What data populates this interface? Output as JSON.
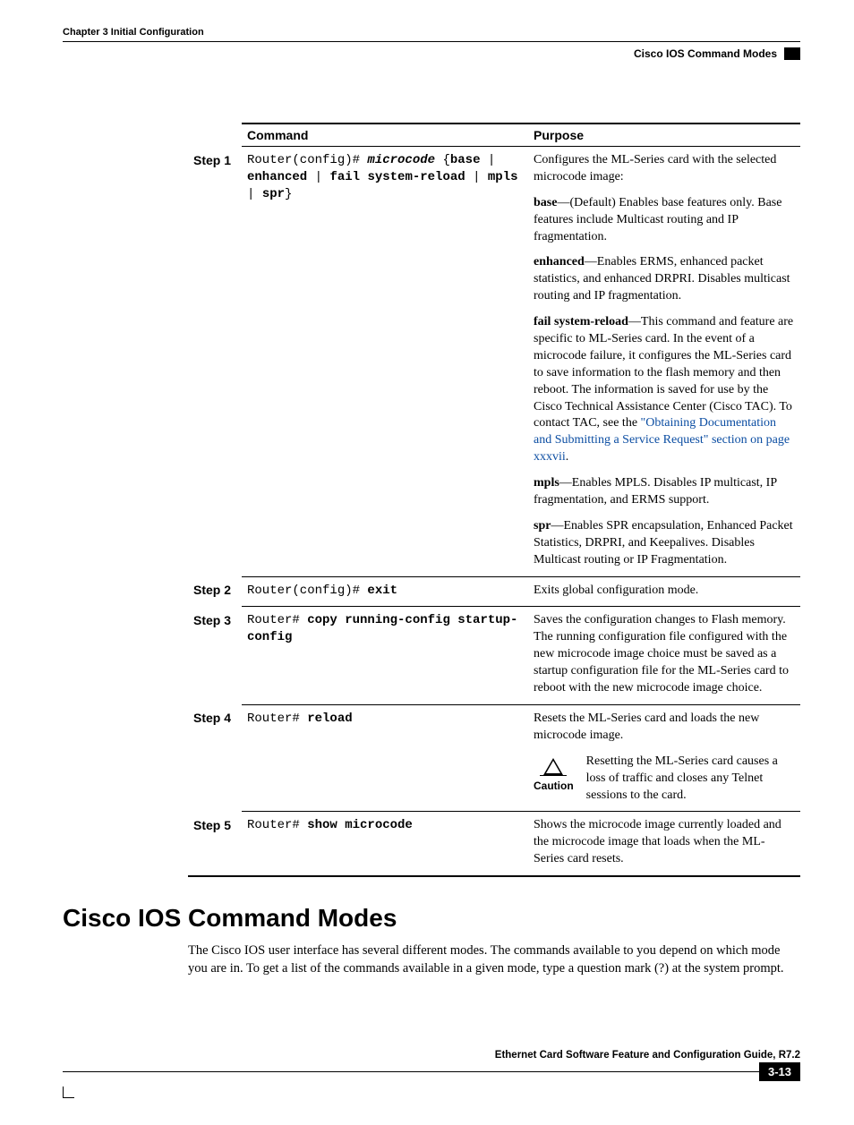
{
  "header": {
    "chapter": "Chapter 3 Initial Configuration",
    "topic": "Cisco IOS Command Modes"
  },
  "table": {
    "headers": {
      "command": "Command",
      "purpose": "Purpose"
    },
    "rows": [
      {
        "step": "Step 1",
        "cmd": {
          "prompt": "Router(config)# ",
          "keyword": "microcode",
          "rest1": " {",
          "opt1": "base",
          "pipe1": " | ",
          "opt2": "enhanced",
          "pipe2": " | ",
          "opt3": "fail system-reload",
          "pipe3": " | ",
          "opt4": "mpls",
          "pipe4": " | ",
          "opt5": "spr",
          "rest2": "}"
        },
        "purpose": {
          "p1": "Configures the ML-Series card with the selected microcode image:",
          "p2a": "base",
          "p2b": "—(Default) Enables base features only. Base features include Multicast routing and IP fragmentation.",
          "p3a": "enhanced",
          "p3b": "—Enables ERMS, enhanced packet statistics, and enhanced DRPRI. Disables multicast routing and IP fragmentation.",
          "p4a": "fail system-reload",
          "p4b": "—This command and feature are specific to ML-Series card. In the event of a microcode failure, it configures the ML-Series card to save information to the flash memory and then reboot. The information is saved for use by the Cisco Technical Assistance Center (Cisco TAC). To contact TAC, see the ",
          "p4link": "\"Obtaining Documentation and Submitting a Service Request\" section on page xxxvii",
          "p4c": ".",
          "p5a": "mpls",
          "p5b": "—Enables MPLS. Disables IP multicast, IP fragmentation, and ERMS support.",
          "p6a": "spr",
          "p6b": "—Enables SPR encapsulation, Enhanced Packet Statistics, DRPRI, and Keepalives. Disables Multicast routing or IP Fragmentation."
        }
      },
      {
        "step": "Step 2",
        "cmd": {
          "prompt": "Router(config)# ",
          "keyword": "exit"
        },
        "purpose": {
          "p1": "Exits global configuration mode."
        }
      },
      {
        "step": "Step 3",
        "cmd": {
          "prompt": "Router# ",
          "keyword": "copy running-config startup-config"
        },
        "purpose": {
          "p1": "Saves the configuration changes to Flash memory. The running configuration file configured with the new microcode image choice must be saved as a startup configuration file for the ML-Series card to reboot with the new microcode image choice."
        }
      },
      {
        "step": "Step 4",
        "cmd": {
          "prompt": "Router# ",
          "keyword": "reload"
        },
        "purpose": {
          "p1": "Resets the ML-Series card and loads the new microcode image.",
          "caution_label": "Caution",
          "caution_text": "Resetting the ML-Series card causes a loss of traffic and closes any Telnet sessions to the card."
        }
      },
      {
        "step": "Step 5",
        "cmd": {
          "prompt": "Router# ",
          "keyword": "show microcode"
        },
        "purpose": {
          "p1": "Shows the microcode image currently loaded and the microcode image that loads when the ML-Series card resets."
        }
      }
    ]
  },
  "section": {
    "title": "Cisco IOS Command Modes",
    "para1": "The Cisco IOS user interface has several different modes. The commands available to you depend on which mode you are in. To get a list of the commands available in a given mode, type a question mark (?) at the system prompt."
  },
  "footer": {
    "doc_title": "Ethernet Card Software Feature and Configuration Guide, R7.2",
    "page_num": "3-13"
  }
}
